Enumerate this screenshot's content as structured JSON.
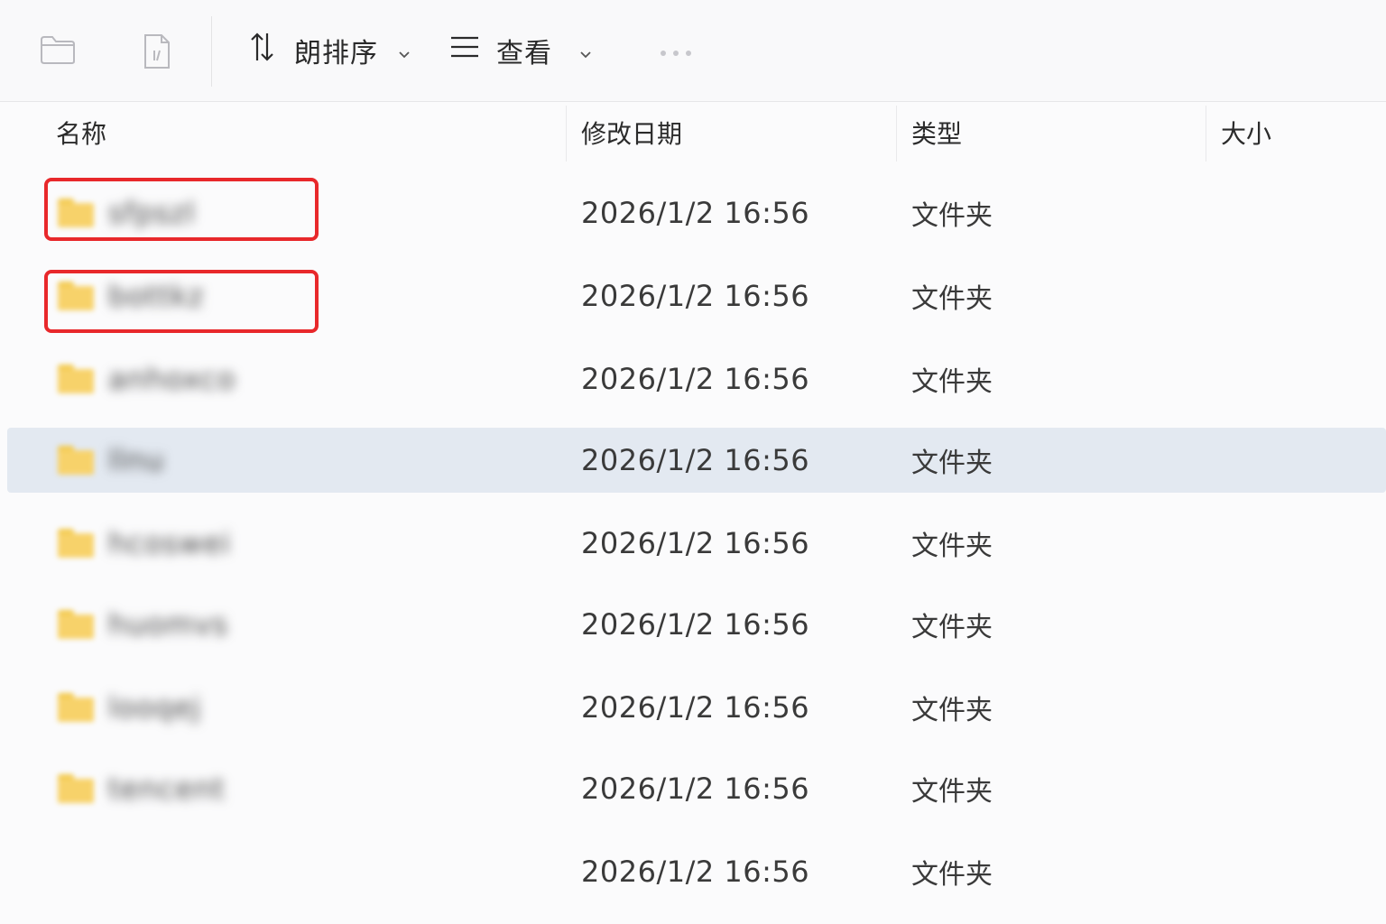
{
  "toolbar": {
    "sort_label": "朗排序",
    "view_label": "查看",
    "icons": [
      "new-folder-icon",
      "new-file-icon",
      "sort-icon",
      "view-icon",
      "more-icon"
    ]
  },
  "columns": {
    "name": "名称",
    "date": "修改日期",
    "type": "类型",
    "size": "大小"
  },
  "rows": [
    {
      "name": "sfpszl",
      "date": "2026/1/2 16:56",
      "type": "文件夹",
      "highlighted": true,
      "selected": false
    },
    {
      "name": "bottkz",
      "date": "2026/1/2 16:56",
      "type": "文件夹",
      "highlighted": true,
      "selected": false
    },
    {
      "name": "anhoxco",
      "date": "2026/1/2 16:56",
      "type": "文件夹",
      "highlighted": false,
      "selected": false
    },
    {
      "name": "llnu",
      "date": "2026/1/2 16:56",
      "type": "文件夹",
      "highlighted": false,
      "selected": true
    },
    {
      "name": "hcoswei",
      "date": "2026/1/2 16:56",
      "type": "文件夹",
      "highlighted": false,
      "selected": false
    },
    {
      "name": "huomvs",
      "date": "2026/1/2 16:56",
      "type": "文件夹",
      "highlighted": false,
      "selected": false
    },
    {
      "name": "looqej",
      "date": "2026/1/2 16:56",
      "type": "文件夹",
      "highlighted": false,
      "selected": false
    },
    {
      "name": "tencent",
      "date": "2026/1/2 16:56",
      "type": "文件夹",
      "highlighted": false,
      "selected": false
    },
    {
      "name": "",
      "date": "2026/1/2 16:56",
      "type": "文件夹",
      "highlighted": false,
      "selected": false
    }
  ],
  "colors": {
    "highlight_border": "#e8282b",
    "selected_row": "#e3e9f1",
    "folder": "#f7d26a"
  }
}
